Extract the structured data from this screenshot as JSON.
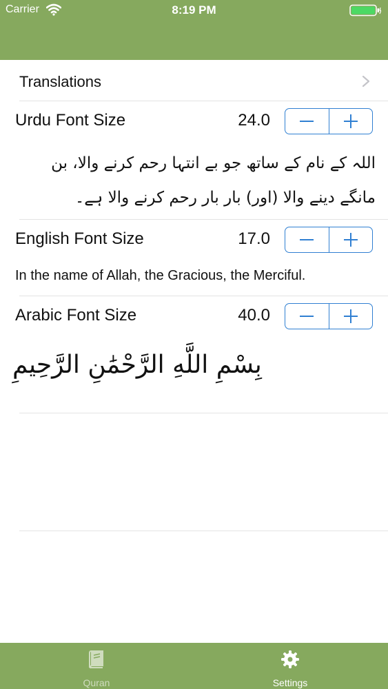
{
  "status_bar": {
    "carrier": "Carrier",
    "time": "8:19 PM"
  },
  "translations": {
    "label": "Translations"
  },
  "urdu": {
    "label": "Urdu Font Size",
    "value": "24.0",
    "sample": "اللہ کے نام کے ساتھ جو بے انتہا رحم کرنے والا، بن مانگے دینے والا (اور) بار بار رحم کرنے والا ہے۔"
  },
  "english": {
    "label": "English Font Size",
    "value": "17.0",
    "sample": "In the name of Allah, the Gracious, the Merciful."
  },
  "arabic": {
    "label": "Arabic Font Size",
    "value": "40.0",
    "sample": "بِسْمِ اللَّهِ الرَّحْمَٰنِ الرَّحِيمِ"
  },
  "tabs": [
    {
      "label": "Quran",
      "icon": "book-icon"
    },
    {
      "label": "Settings",
      "icon": "gear-icon"
    }
  ],
  "colors": {
    "header": "#86a95e",
    "accent": "#2f7fd2",
    "inactive_tab": "#cfdcbe"
  }
}
